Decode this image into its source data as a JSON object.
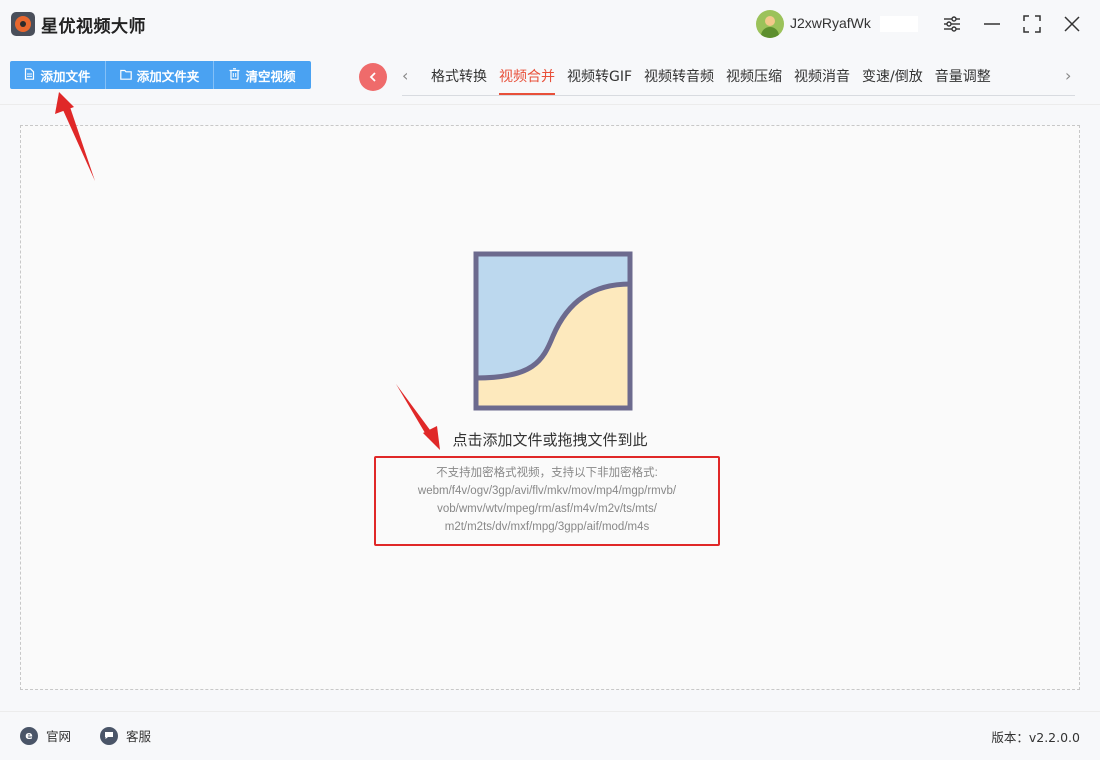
{
  "app": {
    "title": "星优视频大师"
  },
  "user": {
    "name": "J2xwRyafWk"
  },
  "window_controls": [
    "settings-icon",
    "minimize-icon",
    "maximize-icon",
    "close-icon"
  ],
  "toolbar": {
    "add_file": "添加文件",
    "add_folder": "添加文件夹",
    "clear_video": "清空视频"
  },
  "tabs": [
    {
      "label": "格式转换"
    },
    {
      "label": "视频合并"
    },
    {
      "label": "视频转GIF"
    },
    {
      "label": "视频转音频"
    },
    {
      "label": "视频压缩"
    },
    {
      "label": "视频消音"
    },
    {
      "label": "变速/倒放"
    },
    {
      "label": "音量调整"
    }
  ],
  "active_tab": "视频合并",
  "dropzone": {
    "main_text": "点击添加文件或拖拽文件到此",
    "formats_lines": [
      "不支持加密格式视频，支持以下非加密格式:",
      "webm/f4v/ogv/3gp/avi/flv/mkv/mov/mp4/mgp/rmvb/",
      "vob/wmv/wtv/mpeg/rm/asf/m4v/m2v/ts/mts/",
      "m2t/m2ts/dv/mxf/mpg/3gpp/aif/mod/m4s"
    ]
  },
  "footer": {
    "website": "官网",
    "support": "客服",
    "version": "版本：v2.2.0.0"
  },
  "colors": {
    "accent_blue": "#4aa2f2",
    "active_tab": "#e8503a",
    "annotation_red": "#e02828"
  }
}
